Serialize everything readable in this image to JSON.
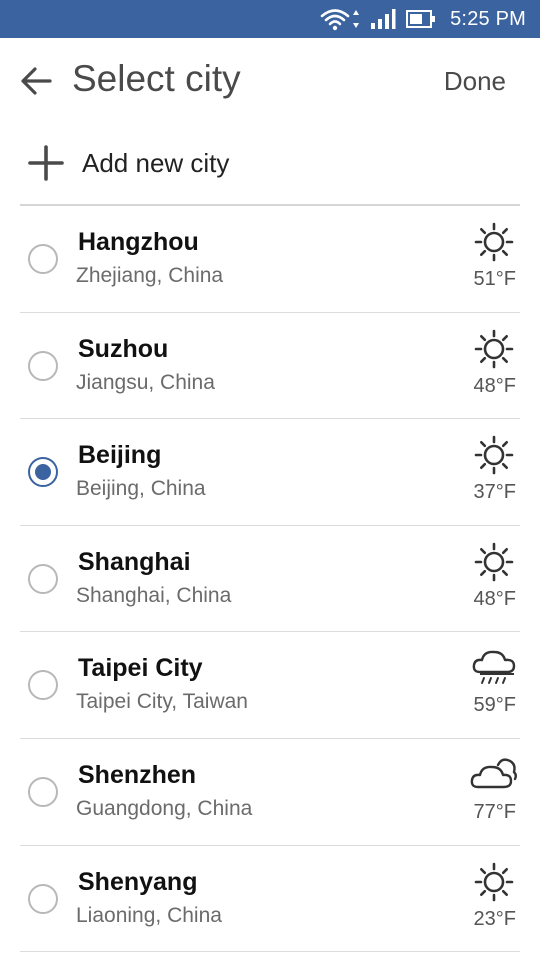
{
  "status_bar": {
    "time": "5:25 PM",
    "icons": [
      "wifi-icon",
      "signal-icon",
      "battery-icon"
    ],
    "color": "#3b63a0"
  },
  "header": {
    "title": "Select city",
    "done_label": "Done",
    "back_icon": "arrow-left-icon"
  },
  "add_city": {
    "label": "Add new city",
    "icon": "plus-icon"
  },
  "cities": [
    {
      "name": "Hangzhou",
      "region": "Zhejiang, China",
      "temp": "51°F",
      "weather": "sun",
      "selected": false
    },
    {
      "name": "Suzhou",
      "region": "Jiangsu, China",
      "temp": "48°F",
      "weather": "sun",
      "selected": false
    },
    {
      "name": "Beijing",
      "region": "Beijing, China",
      "temp": "37°F",
      "weather": "sun",
      "selected": true
    },
    {
      "name": "Shanghai",
      "region": "Shanghai, China",
      "temp": "48°F",
      "weather": "sun",
      "selected": false
    },
    {
      "name": "Taipei City",
      "region": "Taipei City, Taiwan",
      "temp": "59°F",
      "weather": "rain",
      "selected": false
    },
    {
      "name": "Shenzhen",
      "region": "Guangdong, China",
      "temp": "77°F",
      "weather": "cloud",
      "selected": false
    },
    {
      "name": "Shenyang",
      "region": "Liaoning, China",
      "temp": "23°F",
      "weather": "sun",
      "selected": false
    }
  ]
}
